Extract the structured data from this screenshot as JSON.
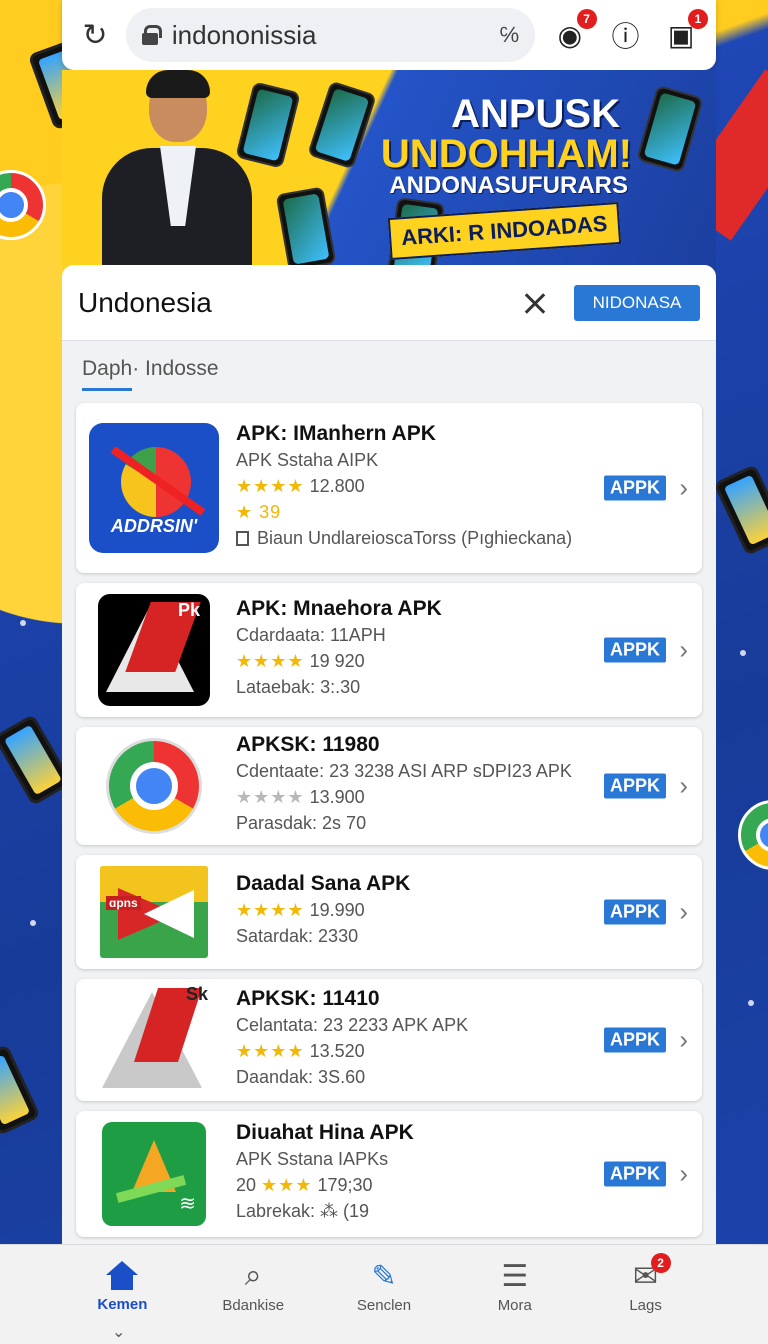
{
  "browser": {
    "url": "indononissia",
    "url_extra_icon": "℅",
    "record_badge": "7",
    "tabs_badge": "1"
  },
  "banner": {
    "title_line1": "ANPUSK",
    "title_line2": "UNDOHHAM!",
    "subtitle": "ANDONASUFURARS",
    "tag": "ARKI: R INDOADAS"
  },
  "search": {
    "value": "Undonesia",
    "button_label": "NIDONASA"
  },
  "tab": {
    "label": "Daph· Indosse"
  },
  "apps": [
    {
      "title": "APK: IManhern APK",
      "line1": "APK Sstaha AIPK",
      "rating": "12.800",
      "stars": "★★★★",
      "extra": "★ 39",
      "extra2": "Biaun UndlareioscaTorss (Pıghieckana)",
      "icon_text": "ADDRSIN'",
      "button": "APPK"
    },
    {
      "title": "APK: Mnaehora APK",
      "line1": "Cdardaata: 11APH",
      "rating": "19 920",
      "stars": "★★★★",
      "extra": "Lataebak:  3:.30",
      "icon_text": "Pk",
      "button": "APPK"
    },
    {
      "title": "APKSK: 11980",
      "line1": "Cdentaate: 23 3238 ASI ARP sDPI23 APK",
      "rating": "13.900",
      "stars": "★★★★",
      "extra": "Parasdak: 2s 70",
      "button": "APPK"
    },
    {
      "title": "Daadal Sana APK",
      "rating": "19.990",
      "stars": "★★★★",
      "extra": "Satardak: 2330",
      "icon_text": "ɑpns",
      "button": "APPK"
    },
    {
      "title": "APKSK: 11410",
      "line1": "Celantata: 23 2233 APK APK",
      "rating": "13.520",
      "stars": "★★★★",
      "extra": "Daandak: 3S.60",
      "icon_text": "Sk",
      "button": "APPK"
    },
    {
      "title": "Diuahat Hina APK",
      "line1": "APK Sstana IAPKs",
      "rating_prefix": "20",
      "rating": "179;30",
      "stars": "★★★",
      "extra": "Labrekak: ⁂ (19",
      "button": "APPK"
    }
  ],
  "nav": [
    {
      "label": "Kemen",
      "icon": "home-icon"
    },
    {
      "label": "Bdankise",
      "icon": "search-icon"
    },
    {
      "label": "Senclen",
      "icon": "edit-icon"
    },
    {
      "label": "Mora",
      "icon": "document-icon"
    },
    {
      "label": "Lags",
      "icon": "mail-icon",
      "badge": "2"
    }
  ],
  "colors": {
    "accent": "#2a78d6",
    "badge": "#e21d1d",
    "star": "#f2b707"
  }
}
